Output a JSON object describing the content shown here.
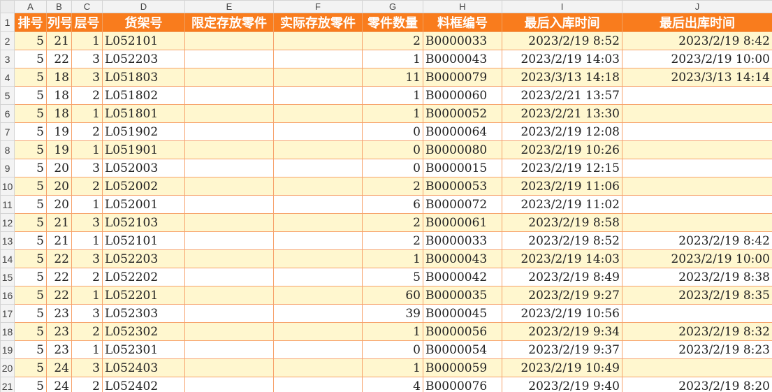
{
  "column_letters": [
    "A",
    "B",
    "C",
    "D",
    "E",
    "F",
    "G",
    "H",
    "I",
    "J"
  ],
  "headers": [
    "排号",
    "列号",
    "层号",
    "货架号",
    "限定存放零件",
    "实际存放零件",
    "零件数量",
    "料框编号",
    "最后入库时间",
    "最后出库时间"
  ],
  "row_numbers": [
    "1",
    "2",
    "3",
    "4",
    "5",
    "6",
    "7",
    "8",
    "9",
    "10",
    "11",
    "12",
    "13",
    "14",
    "15",
    "16",
    "17",
    "18",
    "19",
    "20",
    "21"
  ],
  "rows": [
    [
      "5",
      "21",
      "1",
      "L052101",
      "",
      "",
      "2",
      "B0000033",
      "2023/2/19 8:52",
      "2023/2/19 8:42"
    ],
    [
      "5",
      "22",
      "3",
      "L052203",
      "",
      "",
      "1",
      "B0000043",
      "2023/2/19 14:03",
      "2023/2/19 10:00"
    ],
    [
      "5",
      "18",
      "3",
      "L051803",
      "",
      "",
      "11",
      "B0000079",
      "2023/3/13 14:18",
      "2023/3/13 14:14"
    ],
    [
      "5",
      "18",
      "2",
      "L051802",
      "",
      "",
      "1",
      "B0000060",
      "2023/2/21 13:57",
      ""
    ],
    [
      "5",
      "18",
      "1",
      "L051801",
      "",
      "",
      "1",
      "B0000052",
      "2023/2/21 13:30",
      ""
    ],
    [
      "5",
      "19",
      "2",
      "L051902",
      "",
      "",
      "0",
      "B0000064",
      "2023/2/19 12:08",
      ""
    ],
    [
      "5",
      "19",
      "1",
      "L051901",
      "",
      "",
      "0",
      "B0000080",
      "2023/2/19 10:26",
      ""
    ],
    [
      "5",
      "20",
      "3",
      "L052003",
      "",
      "",
      "0",
      "B0000015",
      "2023/2/19 12:15",
      ""
    ],
    [
      "5",
      "20",
      "2",
      "L052002",
      "",
      "",
      "2",
      "B0000053",
      "2023/2/19 11:06",
      ""
    ],
    [
      "5",
      "20",
      "1",
      "L052001",
      "",
      "",
      "6",
      "B0000072",
      "2023/2/19 11:02",
      ""
    ],
    [
      "5",
      "21",
      "3",
      "L052103",
      "",
      "",
      "2",
      "B0000061",
      "2023/2/19 8:58",
      ""
    ],
    [
      "5",
      "21",
      "1",
      "L052101",
      "",
      "",
      "2",
      "B0000033",
      "2023/2/19 8:52",
      "2023/2/19 8:42"
    ],
    [
      "5",
      "22",
      "3",
      "L052203",
      "",
      "",
      "1",
      "B0000043",
      "2023/2/19 14:03",
      "2023/2/19 10:00"
    ],
    [
      "5",
      "22",
      "2",
      "L052202",
      "",
      "",
      "5",
      "B0000042",
      "2023/2/19 8:49",
      "2023/2/19 8:38"
    ],
    [
      "5",
      "22",
      "1",
      "L052201",
      "",
      "",
      "60",
      "B0000035",
      "2023/2/19 9:27",
      "2023/2/19 8:35"
    ],
    [
      "5",
      "23",
      "3",
      "L052303",
      "",
      "",
      "39",
      "B0000045",
      "2023/2/19 10:56",
      ""
    ],
    [
      "5",
      "23",
      "2",
      "L052302",
      "",
      "",
      "1",
      "B0000056",
      "2023/2/19 9:34",
      "2023/2/19 8:32"
    ],
    [
      "5",
      "23",
      "1",
      "L052301",
      "",
      "",
      "0",
      "B0000054",
      "2023/2/19 9:37",
      "2023/2/19 8:23"
    ],
    [
      "5",
      "24",
      "3",
      "L052403",
      "",
      "",
      "1",
      "B0000059",
      "2023/2/19 10:49",
      ""
    ],
    [
      "5",
      "24",
      "2",
      "L052402",
      "",
      "",
      "4",
      "B0000076",
      "2023/2/19 9:40",
      "2023/2/19 8:20"
    ]
  ],
  "colors": {
    "header_bg": "#f97c1d",
    "band_bg": "#fff7cf",
    "grid": "#f7a26b"
  }
}
